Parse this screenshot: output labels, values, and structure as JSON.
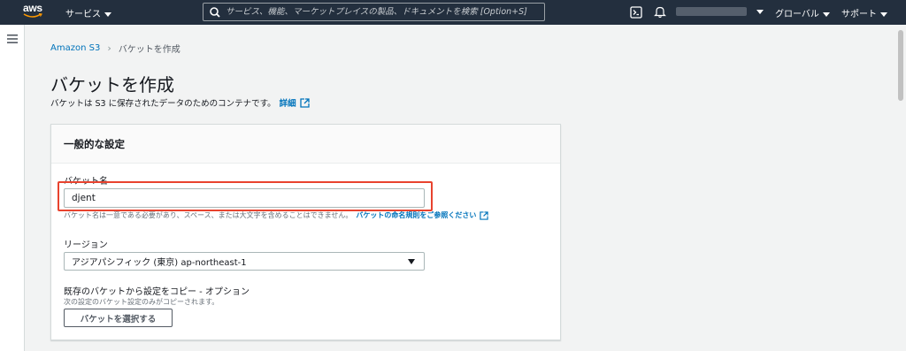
{
  "topnav": {
    "logo_text": "aws",
    "services_label": "サービス",
    "search_placeholder": "サービス、機能、マーケットプレイスの製品、ドキュメントを検索 [Option+S]",
    "region_label": "グローバル",
    "support_label": "サポート",
    "brand_color": "#232f3e",
    "accent_color": "#ff9900"
  },
  "breadcrumb": {
    "root": "Amazon S3",
    "current": "バケットを作成"
  },
  "page": {
    "title": "バケットを作成",
    "description": "バケットは S3 に保存されたデータのためのコンテナです。",
    "details_link": "詳細"
  },
  "panel": {
    "header": "一般的な設定",
    "bucket_name_label": "バケット名",
    "bucket_name_value": "djent",
    "bucket_name_hint": "バケット名は一意である必要があり、スペース、または大文字を含めることはできません。",
    "naming_rules_link": "バケットの命名規則をご参照ください",
    "region_label": "リージョン",
    "region_value": "アジアパシフィック (東京) ap-northeast-1",
    "copy_label": "既存のバケットから設定をコピー - オプション",
    "copy_hint": "次の設定のバケット設定のみがコピーされます。",
    "choose_bucket_button": "バケットを選択する"
  },
  "colors": {
    "link": "#0073bb",
    "highlight": "#e8432e"
  }
}
